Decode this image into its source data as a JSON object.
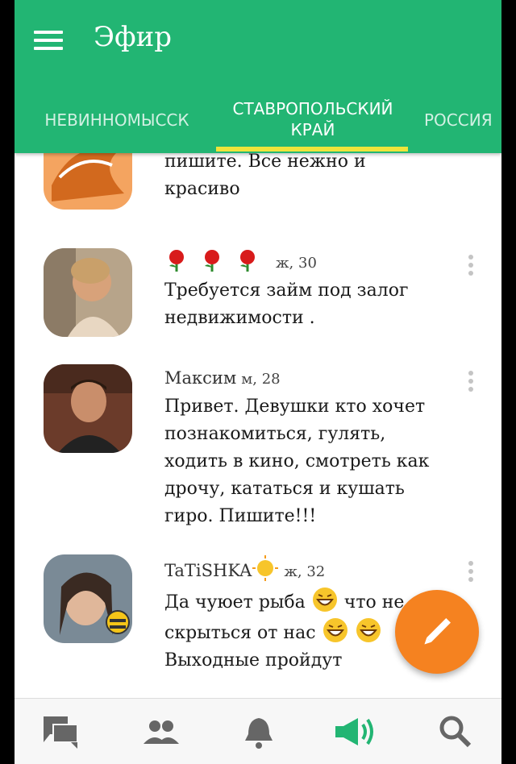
{
  "app": {
    "title": "Эфир"
  },
  "tabs": [
    {
      "label": "НЕВИННОМЫССК"
    },
    {
      "label": "СТАВРОПОЛЬСКИЙ КРАЙ"
    },
    {
      "label": "РОССИЯ"
    }
  ],
  "posts": [
    {
      "text": "Девушки кто любит ласки пишите. Все нежно и красиво"
    },
    {
      "name": "",
      "meta": "ж, 30",
      "text": "Требуется займ под залог недвижимости ."
    },
    {
      "name": "Максим",
      "meta": "м, 28",
      "text": "Привет. Девушки кто хочет познакомиться, гулять, ходить в кино, смотреть как дрочу, кататься и кушать гиро. Пишите!!!"
    },
    {
      "name": "TaTiSHKA",
      "meta": "ж, 32",
      "text_a": "Да чуюет рыба",
      "text_b": "что не скрыться от нас",
      "text_c": "Выходные пройдут"
    }
  ],
  "bottom_nav": [
    {
      "icon": "chat-icon"
    },
    {
      "icon": "people-icon"
    },
    {
      "icon": "bell-icon"
    },
    {
      "icon": "megaphone-icon"
    },
    {
      "icon": "search-icon"
    }
  ],
  "colors": {
    "primary": "#22b573",
    "indicator": "#f0e43a",
    "fab": "#f58220"
  }
}
